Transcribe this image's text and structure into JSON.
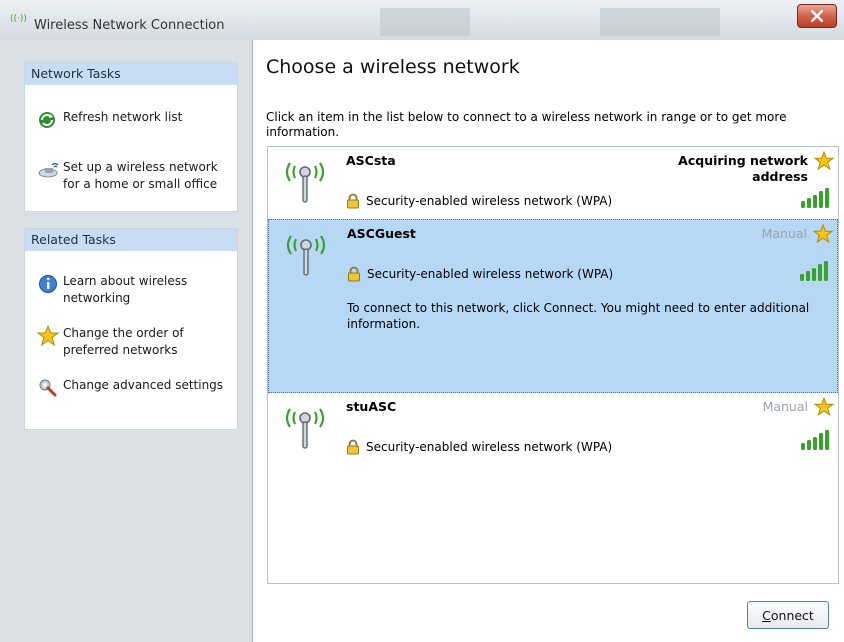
{
  "window": {
    "title": "Wireless Network Connection"
  },
  "sidebar": {
    "network_tasks": {
      "header": "Network Tasks",
      "items": [
        {
          "label": "Refresh network list",
          "icon": "refresh-icon"
        },
        {
          "label": "Set up a wireless network for a home or small office",
          "icon": "setup-wireless-icon"
        }
      ]
    },
    "related_tasks": {
      "header": "Related Tasks",
      "items": [
        {
          "label": "Learn about wireless networking",
          "icon": "info-icon"
        },
        {
          "label": "Change the order of preferred networks",
          "icon": "star-icon"
        },
        {
          "label": "Change advanced settings",
          "icon": "settings-icon"
        }
      ]
    }
  },
  "main": {
    "title": "Choose a wireless network",
    "instructions": "Click an item in the list below to connect to a wireless network in range or to get more information.",
    "networks": [
      {
        "name": "ASCsta",
        "status": "Acquiring network address",
        "security": "Security-enabled wireless network (WPA)",
        "signal": 5,
        "selected": false
      },
      {
        "name": "ASCGuest",
        "status": "Manual",
        "security": "Security-enabled wireless network (WPA)",
        "signal": 5,
        "selected": true,
        "description": "To connect to this network, click Connect. You might need to enter additional information."
      },
      {
        "name": "stuASC",
        "status": "Manual",
        "security": "Security-enabled wireless network (WPA)",
        "signal": 5,
        "selected": false
      }
    ],
    "connect_button": {
      "accel": "C",
      "rest": "onnect"
    }
  },
  "colors": {
    "selection": "#b7d8f5",
    "task_header": "#c8ddf3",
    "signal_green": "#3aa12c",
    "star_gold": "#f5c518"
  }
}
